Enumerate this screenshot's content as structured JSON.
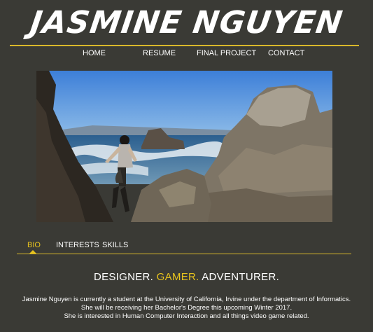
{
  "header": {
    "logo_text": "JASMINE NGUYEN",
    "accent_color": "#e6c21e"
  },
  "nav": {
    "items": [
      {
        "label": "HOME"
      },
      {
        "label": "RESUME"
      },
      {
        "label": "FINAL PROJECT"
      },
      {
        "label": "CONTACT"
      }
    ]
  },
  "tabs": {
    "items": [
      {
        "label": "BIO",
        "active": true
      },
      {
        "label": "INTERESTS",
        "active": false
      },
      {
        "label": "SKILLS",
        "active": false
      }
    ]
  },
  "bio": {
    "headline_1": "DESIGNER.",
    "headline_2": "GAMER.",
    "headline_3": "ADVENTURER.",
    "lines": [
      "Jasmine Nguyen is currently a student at the University of California, Irvine under the department of Informatics.",
      "She will be receiving her Bachelor's Degree this upcoming Winter 2017.",
      "She is interested in Human Computer Interaction and all things video game related."
    ]
  }
}
